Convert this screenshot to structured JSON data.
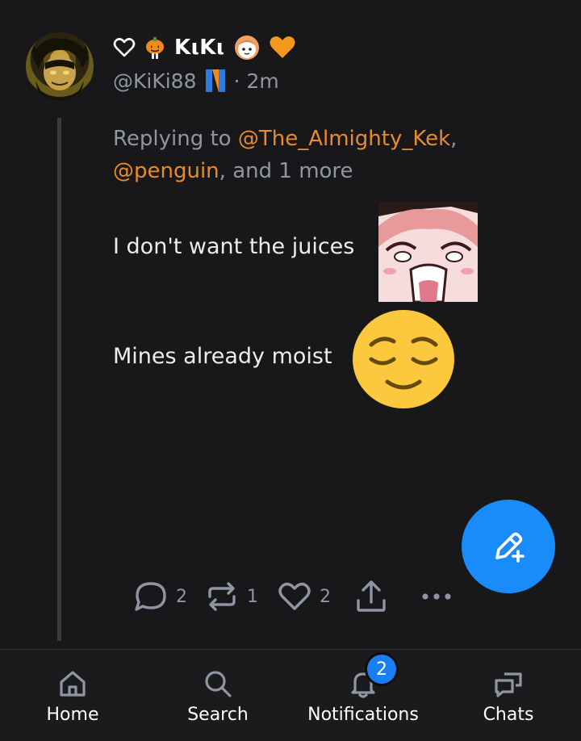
{
  "post": {
    "display_name": "KιKι",
    "handle": "@KiKi88",
    "separator": "·",
    "time_ago": "2m",
    "replying_prefix": "Replying to",
    "mentions": [
      "@The_Almighty_Kek",
      "@penguin"
    ],
    "mention_separator": ",",
    "replying_suffix": ", and 1 more",
    "lines": [
      "I don't want the juices",
      "Mines already moist"
    ],
    "name_icons": [
      "heart-outline-icon",
      "pumpkin-icon",
      "chibi-character-icon",
      "orange-heart-icon"
    ],
    "handle_badge_icon": "n-verified-badge-icon",
    "stickers": [
      "screaming-anime-girl-sticker",
      "relieved-face-emoji"
    ]
  },
  "actions": {
    "replies": "2",
    "reposts": "1",
    "likes": "2"
  },
  "fab": {
    "icon": "compose-pencil-icon"
  },
  "nav": {
    "items": [
      {
        "label": "Home",
        "icon": "home-icon"
      },
      {
        "label": "Search",
        "icon": "search-icon"
      },
      {
        "label": "Notifications",
        "icon": "bell-icon"
      },
      {
        "label": "Chats",
        "icon": "chat-icon"
      }
    ],
    "notifications_badge": "2"
  },
  "colors": {
    "background": "#18181a",
    "mention": "#e88a2e",
    "muted": "#8e95a3",
    "accent": "#1a8cfa"
  }
}
